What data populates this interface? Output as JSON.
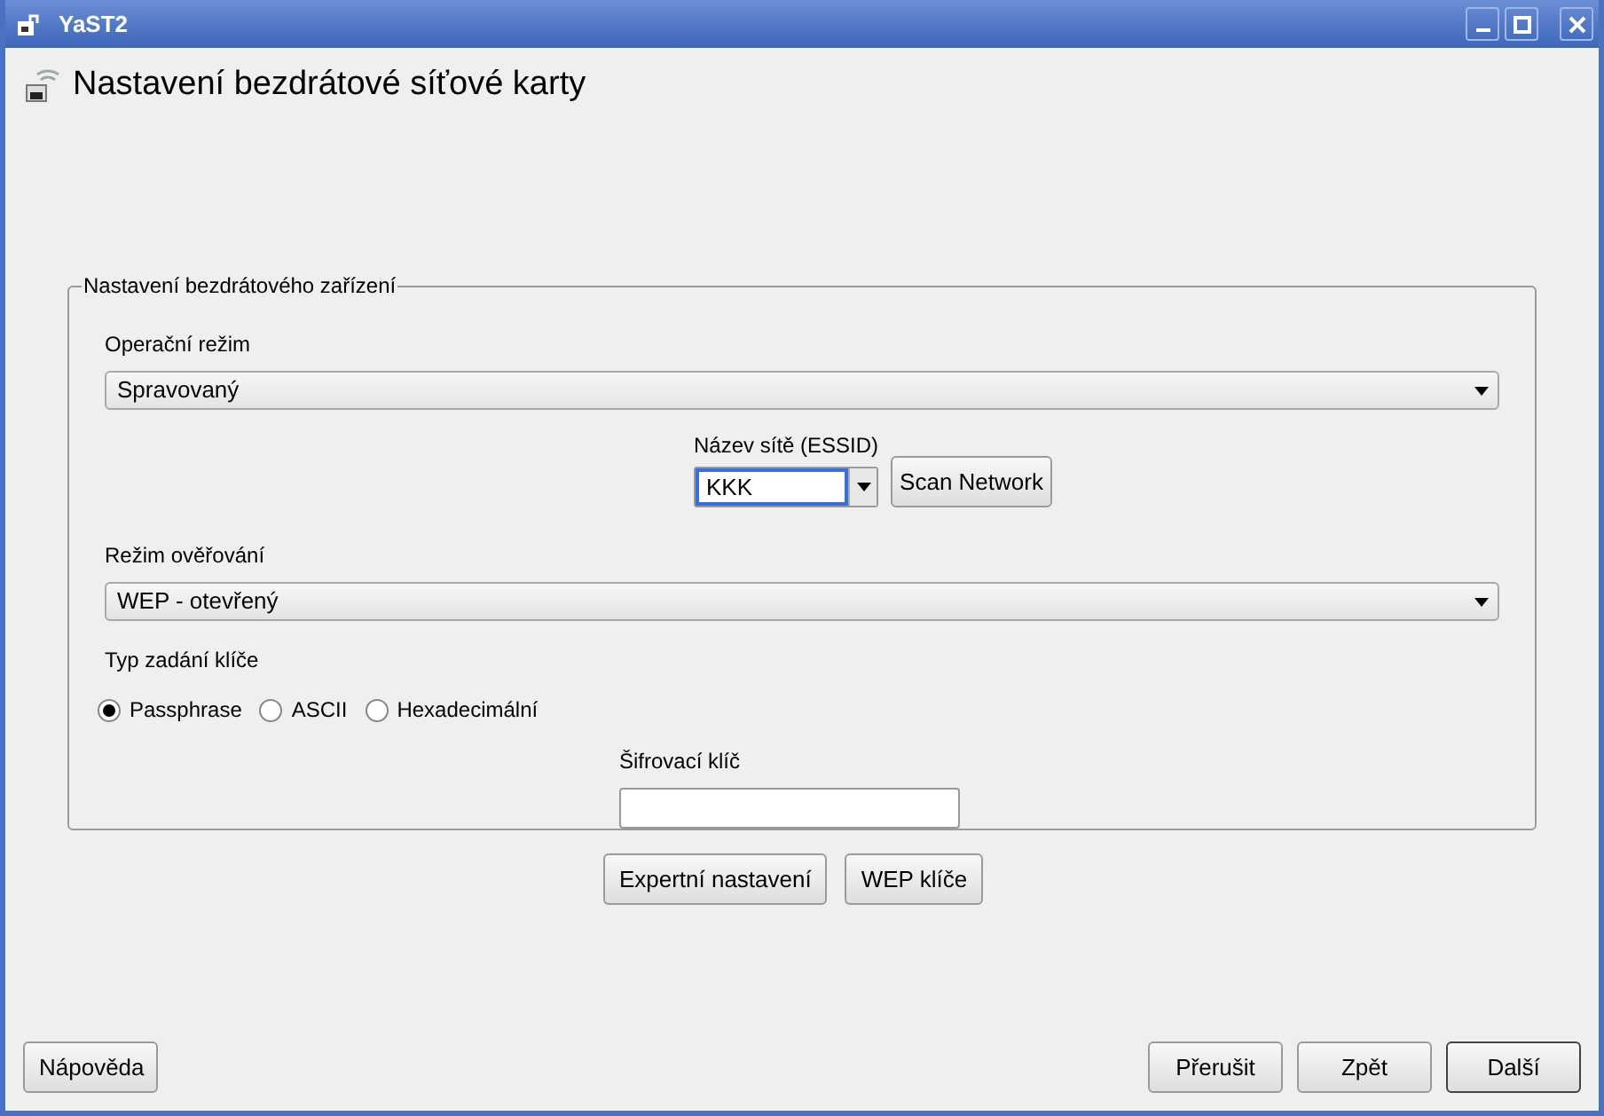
{
  "window": {
    "title": "YaST2"
  },
  "heading": "Nastavení bezdrátové síťové karty",
  "group": {
    "title": "Nastavení bezdrátového zařízení",
    "operating_mode": {
      "label": "Operační režim",
      "value": "Spravovaný"
    },
    "essid": {
      "label": "Název sítě (ESSID)",
      "value": "KKK",
      "focused": true
    },
    "scan_button": "Scan Network",
    "auth_mode": {
      "label": "Režim ověřování",
      "value": "WEP - otevřený"
    },
    "key_type": {
      "label": "Typ zadání klíče",
      "options": [
        {
          "label": "Passphrase",
          "selected": true
        },
        {
          "label": "ASCII",
          "selected": false
        },
        {
          "label": "Hexadecimální",
          "selected": false
        }
      ]
    },
    "encryption_key": {
      "label": "Šifrovací klíč"
    }
  },
  "buttons": [
    "Expertní nastavení",
    "WEP klíče"
  ],
  "footer": {
    "help": "Nápověda",
    "actions": [
      {
        "label": "Přerušit",
        "default": false
      },
      {
        "label": "Zpět",
        "default": false
      },
      {
        "label": "Další",
        "default": true
      }
    ]
  }
}
